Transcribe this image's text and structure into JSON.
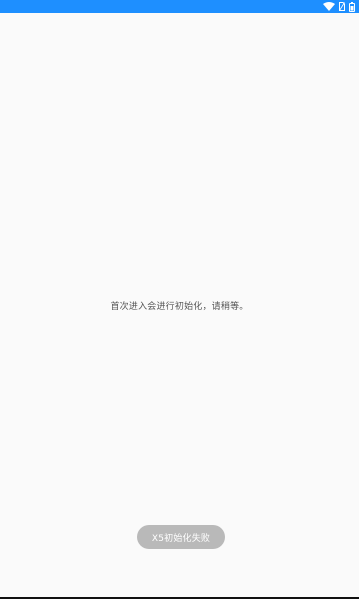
{
  "status_bar": {
    "background_color": "#1e8fff",
    "icons": [
      "wifi-icon",
      "no-sim-icon",
      "battery-icon"
    ]
  },
  "main": {
    "message": "首次进入会进行初始化，请稍等。"
  },
  "toast": {
    "text": "X5初始化失败"
  }
}
